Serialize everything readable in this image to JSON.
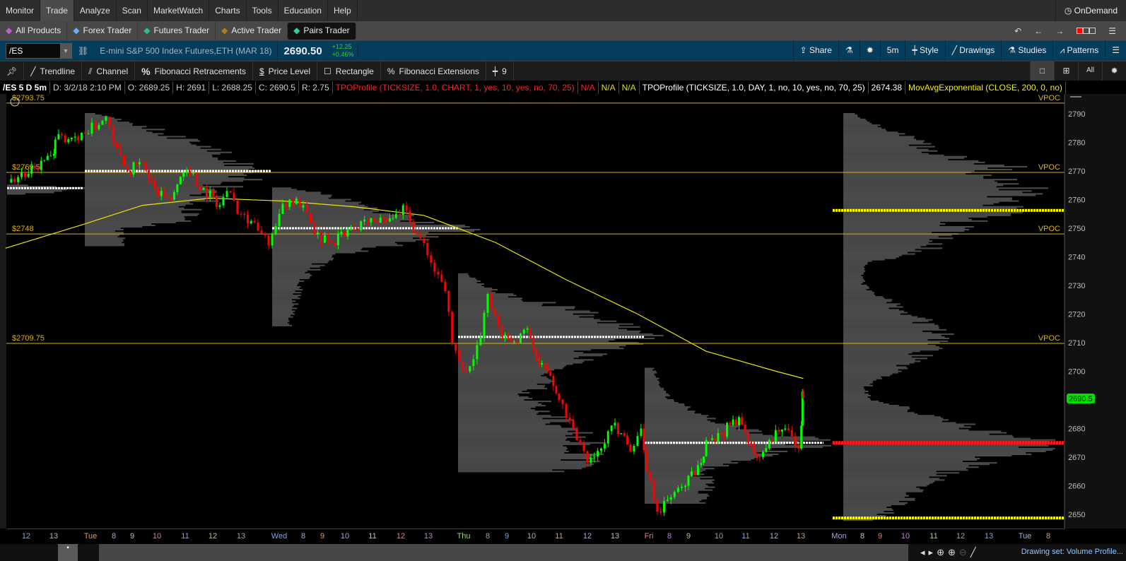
{
  "menu": [
    "Monitor",
    "Trade",
    "Analyze",
    "Scan",
    "MarketWatch",
    "Charts",
    "Tools",
    "Education",
    "Help"
  ],
  "active_menu": "Trade",
  "ondemand": "OnDemand",
  "subnav": [
    {
      "label": "All Products",
      "icon": "all-products-icon",
      "color": "#c060d0"
    },
    {
      "label": "Forex Trader",
      "icon": "forex-icon",
      "color": "#6ab0f0"
    },
    {
      "label": "Futures Trader",
      "icon": "futures-icon",
      "color": "#30c080"
    },
    {
      "label": "Active Trader",
      "icon": "active-trader-icon",
      "color": "#b07a20"
    },
    {
      "label": "Pairs Trader",
      "icon": "pairs-icon",
      "color": "#30d0a0"
    }
  ],
  "active_subnav": "Pairs Trader",
  "symbol": {
    "value": "/ES",
    "description": "E-mini S&P 500 Index Futures,ETH (MAR 18)",
    "last": "2690.50",
    "change": "+12.25",
    "change_pct": "+0.46%"
  },
  "chart_toolbar": {
    "share": "Share",
    "timeframe": "5m",
    "style": "Style",
    "drawings": "Drawings",
    "studies": "Studies",
    "patterns": "Patterns"
  },
  "drawing_tools": [
    "Trendline",
    "Channel",
    "Fibonacci Retracements",
    "Price Level",
    "Rectangle",
    "Fibonacci Extensions",
    "9"
  ],
  "layout_buttons": [
    "single",
    "grid",
    "All",
    "settings"
  ],
  "info": {
    "symbol": "/ES 5 D 5m",
    "date": "D: 3/2/18 2:10 PM",
    "open": "O: 2689.25",
    "high": "H: 2691",
    "low": "L: 2688.25",
    "close": "C: 2690.5",
    "range": "R: 2.75",
    "study1": "TPOProfile (TICKSIZE, 1.0, CHART, 1, yes, 10, yes, no, 70, 25)",
    "na1": "N/A",
    "na2": "N/A",
    "na3": "N/A",
    "study2": "TPOProfile (TICKSIZE, 1.0, DAY, 1, no, 10, yes, no, 70, 25)",
    "study2_val": "2674.38",
    "study3": "MovAvgExponential (CLOSE, 200, 0, no)"
  },
  "colors": {
    "up": "#00ff00",
    "down": "#ff0000",
    "ema": "#e6e600",
    "level": "#e0b000",
    "profile": "#4a4a4a",
    "poc": "#ffffff",
    "composite_poc": "#ff1a1a",
    "value_area": "#ffff00",
    "price_badge": "#00e000"
  },
  "chart_data": {
    "type": "candlestick",
    "price_axis": {
      "ticks": [
        2650,
        2660,
        2670,
        2680,
        2690,
        2700,
        2710,
        2720,
        2730,
        2740,
        2750,
        2760,
        2770,
        2780,
        2790
      ],
      "range": [
        2645,
        2797
      ]
    },
    "time_axis": [
      "12",
      "13",
      "Tue",
      "8",
      "9",
      "10",
      "11",
      "12",
      "13",
      "Wed",
      "8",
      "9",
      "10",
      "11",
      "12",
      "13",
      "Thu",
      "8",
      "9",
      "10",
      "11",
      "12",
      "13",
      "Fri",
      "8",
      "9",
      "10",
      "11",
      "12",
      "13",
      "Mon",
      "8",
      "9",
      "10",
      "11",
      "12",
      "13",
      "Tue",
      "8"
    ],
    "current_price": "2690.5",
    "price_path": [
      [
        "Mon 11:20",
        2766
      ],
      [
        "Mon 12:05",
        2769
      ],
      [
        "Mon 13:05",
        2776
      ],
      [
        "Mon 13:35",
        2781
      ],
      [
        "Tue 0:00",
        2783
      ],
      [
        "Tue 5:50",
        2789
      ],
      [
        "Tue 8:10",
        2778
      ],
      [
        "Tue 8:45",
        2770
      ],
      [
        "Tue 9:25",
        2773
      ],
      [
        "Tue 9:55",
        2764
      ],
      [
        "Tue 10:30",
        2760
      ],
      [
        "Tue 10:50",
        2768
      ],
      [
        "Tue 11:10",
        2769
      ],
      [
        "Tue 11:40",
        2764
      ],
      [
        "Tue 12:15",
        2758
      ],
      [
        "Tue 12:30",
        2763
      ],
      [
        "Tue 13:00",
        2755
      ],
      [
        "Tue 17:45",
        2752
      ],
      [
        "Tue 22:45",
        2744
      ],
      [
        "Wed 1:50",
        2755
      ],
      [
        "Wed 4:30",
        2760
      ],
      [
        "Wed 8:00",
        2758
      ],
      [
        "Wed 8:35",
        2748
      ],
      [
        "Wed 9:25",
        2745
      ],
      [
        "Wed 10:20",
        2750
      ],
      [
        "Wed 10:50",
        2752
      ],
      [
        "Wed 11:50",
        2755
      ],
      [
        "Wed 12:05",
        2758
      ],
      [
        "Wed 12:35",
        2748
      ],
      [
        "Wed 14:00",
        2738
      ],
      [
        "Wed 19:15",
        2728
      ],
      [
        "Wed 21:50",
        2710
      ],
      [
        "Thu 2:15",
        2700
      ],
      [
        "Thu 6:05",
        2712
      ],
      [
        "Thu 8:00",
        2727
      ],
      [
        "Thu 8:45",
        2712
      ],
      [
        "Thu 9:25",
        2710
      ],
      [
        "Thu 9:50",
        2715
      ],
      [
        "Thu 10:10",
        2705
      ],
      [
        "Thu 10:35",
        2700
      ],
      [
        "Thu 11:00",
        2690
      ],
      [
        "Thu 11:30",
        2680
      ],
      [
        "Thu 12:00",
        2668
      ],
      [
        "Thu 12:30",
        2673
      ],
      [
        "Thu 13:00",
        2682
      ],
      [
        "Thu 18:45",
        2672
      ],
      [
        "Thu 22:40",
        2680
      ],
      [
        "Fri 0:40",
        2665
      ],
      [
        "Fri 4:05",
        2651
      ],
      [
        "Fri 8:05",
        2656
      ],
      [
        "Fri 8:50",
        2660
      ],
      [
        "Fri 9:25",
        2668
      ],
      [
        "Fri 9:35",
        2676
      ],
      [
        "Fri 10:05",
        2678
      ],
      [
        "Fri 10:45",
        2684
      ],
      [
        "Fri 11:05",
        2675
      ],
      [
        "Fri 11:30",
        2670
      ],
      [
        "Fri 11:50",
        2676
      ],
      [
        "Fri 12:25",
        2680
      ],
      [
        "Fri 12:55",
        2673
      ],
      [
        "Fri 13:10",
        2681
      ],
      [
        "Fri 13:35",
        2693
      ],
      [
        "Fri 13:50",
        2690.5
      ]
    ],
    "ema_200": [
      [
        "Mon 11:15",
        2743
      ],
      [
        "Tue 0:00",
        2751.5
      ],
      [
        "Tue 9:25",
        2758
      ],
      [
        "Tue 11:55",
        2760.5
      ],
      [
        "Wed 2:45",
        2759.5
      ],
      [
        "Wed 10:20",
        2757.5
      ],
      [
        "Wed 12:50",
        2754.5
      ],
      [
        "Thu 8:25",
        2745
      ],
      [
        "Thu 11:15",
        2732
      ],
      [
        "Thu 21:25",
        2720
      ],
      [
        "Fri 9:35",
        2707
      ],
      [
        "Fri 12:05",
        2700
      ],
      [
        "Fri 13:50",
        2697.5
      ]
    ],
    "price_levels": [
      {
        "label": "$2793.75",
        "price": 2793.75,
        "tag": "VPOC"
      },
      {
        "label": "$2769.5",
        "price": 2769.5,
        "tag": "VPOC"
      },
      {
        "label": "$2748",
        "price": 2748,
        "tag": "VPOC"
      },
      {
        "label": "$2709.75",
        "price": 2709.75,
        "tag": "VPOC"
      }
    ],
    "daily_profiles": [
      {
        "start": "Mon 11:00",
        "poc": 2764,
        "nodes": [
          [
            2762,
            0.3
          ],
          [
            2763,
            0.8
          ],
          [
            2764,
            1
          ],
          [
            2765,
            0.3
          ]
        ]
      },
      {
        "start": "Tue 0:00",
        "poc": 2770,
        "nodes": [
          [
            2744,
            0.2
          ],
          [
            2750,
            0.2
          ],
          [
            2752,
            0.5
          ],
          [
            2758,
            0.6
          ],
          [
            2762,
            0.7
          ],
          [
            2766,
            0.8
          ],
          [
            2770,
            1
          ],
          [
            2774,
            0.7
          ],
          [
            2778,
            0.7
          ],
          [
            2782,
            0.5
          ],
          [
            2786,
            0.3
          ],
          [
            2790,
            0.05
          ]
        ]
      },
      {
        "start": "Wed 0:00",
        "poc": 2750,
        "nodes": [
          [
            2716,
            0.1
          ],
          [
            2730,
            0.15
          ],
          [
            2740,
            0.3
          ],
          [
            2746,
            0.8
          ],
          [
            2750,
            1
          ],
          [
            2754,
            0.7
          ],
          [
            2758,
            0.5
          ],
          [
            2762,
            0.3
          ],
          [
            2764,
            0.1
          ]
        ]
      },
      {
        "start": "Thu 0:00",
        "poc": 2712,
        "nodes": [
          [
            2665,
            0.6
          ],
          [
            2670,
            0.7
          ],
          [
            2675,
            0.7
          ],
          [
            2680,
            0.6
          ],
          [
            2685,
            0.5
          ],
          [
            2692,
            0.4
          ],
          [
            2700,
            0.5
          ],
          [
            2706,
            0.7
          ],
          [
            2712,
            1
          ],
          [
            2718,
            0.8
          ],
          [
            2722,
            0.6
          ],
          [
            2728,
            0.2
          ],
          [
            2734,
            0.05
          ]
        ]
      },
      {
        "start": "Fri 0:00",
        "poc": 2675,
        "nodes": [
          [
            2654,
            0.3
          ],
          [
            2660,
            0.4
          ],
          [
            2665,
            0.3
          ],
          [
            2670,
            0.6
          ],
          [
            2675,
            1
          ],
          [
            2680,
            0.6
          ],
          [
            2685,
            0.3
          ],
          [
            2690,
            0.15
          ],
          [
            2695,
            0.1
          ],
          [
            2701,
            0.05
          ]
        ]
      }
    ],
    "composite_profile": {
      "poc": 2675,
      "value_area_high": 2756.25,
      "value_area_low": 2648.75,
      "nodes": [
        [
          2648,
          0.15
        ],
        [
          2655,
          0.3
        ],
        [
          2660,
          0.35
        ],
        [
          2665,
          0.5
        ],
        [
          2670,
          0.75
        ],
        [
          2675,
          1
        ],
        [
          2680,
          0.6
        ],
        [
          2685,
          0.4
        ],
        [
          2690,
          0.15
        ],
        [
          2694,
          0.1
        ],
        [
          2700,
          0.25
        ],
        [
          2705,
          0.35
        ],
        [
          2710,
          0.45
        ],
        [
          2715,
          0.45
        ],
        [
          2720,
          0.3
        ],
        [
          2730,
          0.1
        ],
        [
          2738,
          0.1
        ],
        [
          2742,
          0.4
        ],
        [
          2748,
          0.5
        ],
        [
          2752,
          0.55
        ],
        [
          2756,
          0.8
        ],
        [
          2760,
          0.75
        ],
        [
          2764,
          0.85
        ],
        [
          2768,
          0.65
        ],
        [
          2772,
          0.75
        ],
        [
          2776,
          0.45
        ],
        [
          2780,
          0.35
        ],
        [
          2784,
          0.25
        ],
        [
          2788,
          0.1
        ],
        [
          2790,
          0.05
        ]
      ]
    }
  },
  "footer": {
    "drawing_set": "Drawing set: Volume Profile..."
  }
}
